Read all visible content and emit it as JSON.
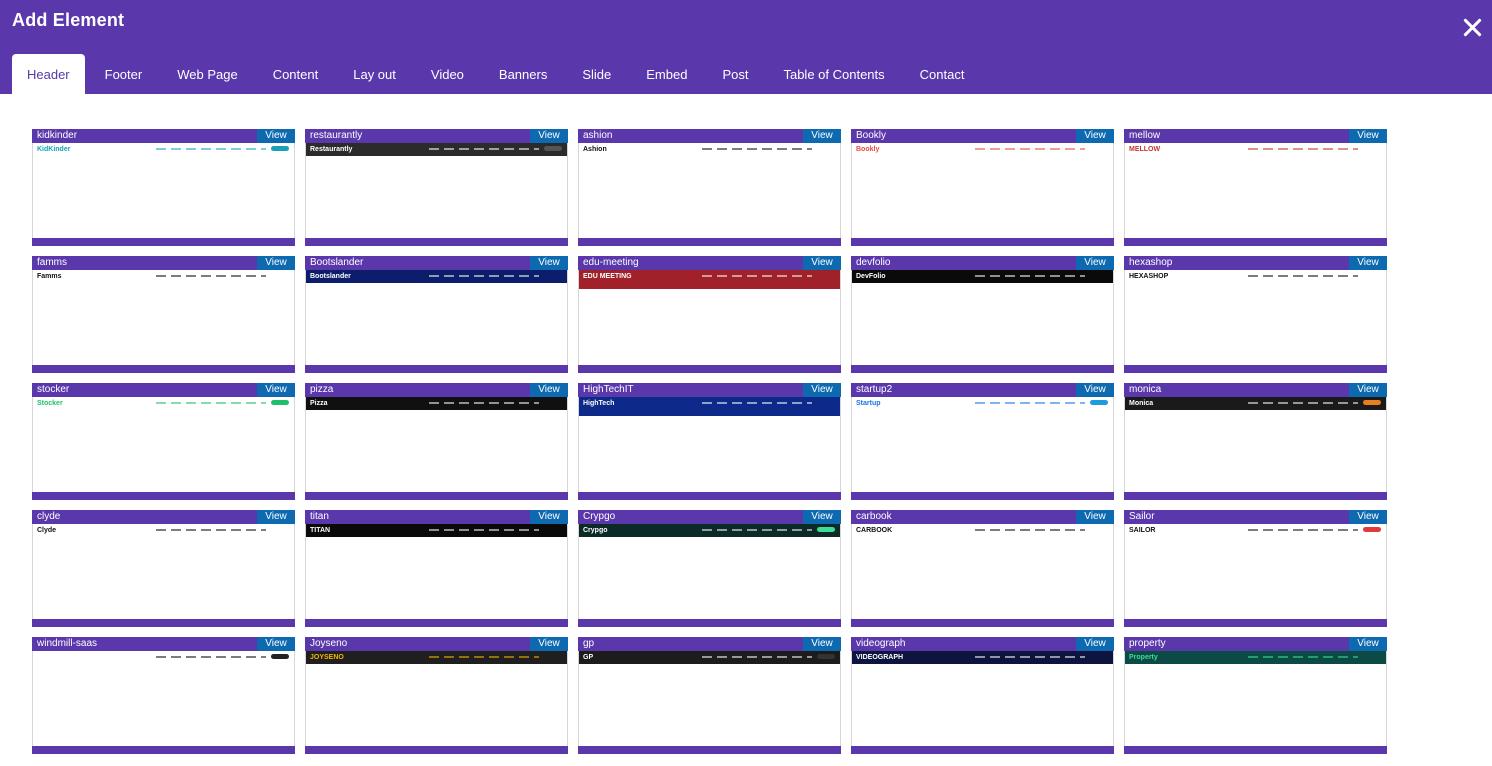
{
  "dialog": {
    "title": "Add Element",
    "close_icon": "close-x-icon"
  },
  "tabs": [
    {
      "label": "Header",
      "active": true
    },
    {
      "label": "Footer",
      "active": false
    },
    {
      "label": "Web Page",
      "active": false
    },
    {
      "label": "Content",
      "active": false
    },
    {
      "label": "Lay out",
      "active": false
    },
    {
      "label": "Video",
      "active": false
    },
    {
      "label": "Banners",
      "active": false
    },
    {
      "label": "Slide",
      "active": false
    },
    {
      "label": "Embed",
      "active": false
    },
    {
      "label": "Post",
      "active": false
    },
    {
      "label": "Table of Contents",
      "active": false
    },
    {
      "label": "Contact",
      "active": false
    }
  ],
  "view_label": "View",
  "colors": {
    "brand": "#5a38ab",
    "view_button": "#0d6ab1"
  },
  "templates": [
    {
      "name": "kidkinder",
      "logo": "KidKinder",
      "bg": "#ffffff",
      "fg": "#17a2b8",
      "btn": "#17a2b8"
    },
    {
      "name": "restaurantly",
      "logo": "Restaurantly",
      "bg": "#2b2b2b",
      "fg": "#ffffff",
      "btn": "#555555"
    },
    {
      "name": "ashion",
      "logo": "Ashion",
      "bg": "#ffffff",
      "fg": "#111111",
      "btn": ""
    },
    {
      "name": "Bookly",
      "logo": "Bookly",
      "bg": "#ffffff",
      "fg": "#e74c3c",
      "btn": ""
    },
    {
      "name": "mellow",
      "logo": "MELLOW",
      "bg": "#ffffff",
      "fg": "#c0392b",
      "btn": ""
    },
    {
      "name": "famms",
      "logo": "Famms",
      "bg": "#ffffff",
      "fg": "#111111",
      "btn": ""
    },
    {
      "name": "Bootslander",
      "logo": "Bootslander",
      "bg": "#0b1d6b",
      "fg": "#ffffff",
      "btn": ""
    },
    {
      "name": "edu-meeting",
      "logo": "EDU MEETING",
      "bg": "#a0212a",
      "fg": "#ffffff",
      "btn": ""
    },
    {
      "name": "devfolio",
      "logo": "DevFolio",
      "bg": "#0a0a0a",
      "fg": "#ffffff",
      "btn": ""
    },
    {
      "name": "hexashop",
      "logo": "HEXASHOP",
      "bg": "#ffffff",
      "fg": "#111111",
      "btn": ""
    },
    {
      "name": "stocker",
      "logo": "Stocker",
      "bg": "#ffffff",
      "fg": "#20c06a",
      "btn": "#20c06a"
    },
    {
      "name": "pizza",
      "logo": "Pizza",
      "bg": "#101010",
      "fg": "#ffffff",
      "btn": ""
    },
    {
      "name": "HighTechIT",
      "logo": "HighTech",
      "bg": "#0d2a8a",
      "fg": "#ffffff",
      "btn": ""
    },
    {
      "name": "startup2",
      "logo": "Startup",
      "bg": "#ffffff",
      "fg": "#1a73e8",
      "btn": "#1e9be0"
    },
    {
      "name": "monica",
      "logo": "Monica",
      "bg": "#1a1a1a",
      "fg": "#ffffff",
      "btn": "#e67e22"
    },
    {
      "name": "clyde",
      "logo": "Clyde",
      "bg": "#ffffff",
      "fg": "#111111",
      "btn": ""
    },
    {
      "name": "titan",
      "logo": "TITAN",
      "bg": "#0a0a0a",
      "fg": "#ffffff",
      "btn": ""
    },
    {
      "name": "Crypgo",
      "logo": "Crypgo",
      "bg": "#0b2a28",
      "fg": "#ffffff",
      "btn": "#3ddc97"
    },
    {
      "name": "carbook",
      "logo": "CARBOOK",
      "bg": "#ffffff",
      "fg": "#111111",
      "btn": ""
    },
    {
      "name": "Sailor",
      "logo": "SAILOR",
      "bg": "#ffffff",
      "fg": "#111111",
      "btn": "#e03a3a"
    },
    {
      "name": "windmill-saas",
      "logo": "",
      "bg": "#ffffff",
      "fg": "#111111",
      "btn": "#222222"
    },
    {
      "name": "Joyseno",
      "logo": "JOYSENO",
      "bg": "#1f1f1f",
      "fg": "#f4b400",
      "btn": ""
    },
    {
      "name": "gp",
      "logo": "GP",
      "bg": "#1c1c1c",
      "fg": "#ffffff",
      "btn": "#333333"
    },
    {
      "name": "videograph",
      "logo": "VIDEOGRAPH",
      "bg": "#0d1440",
      "fg": "#ffffff",
      "btn": ""
    },
    {
      "name": "property",
      "logo": "Property",
      "bg": "#0b4a45",
      "fg": "#3ddc97",
      "btn": ""
    }
  ]
}
